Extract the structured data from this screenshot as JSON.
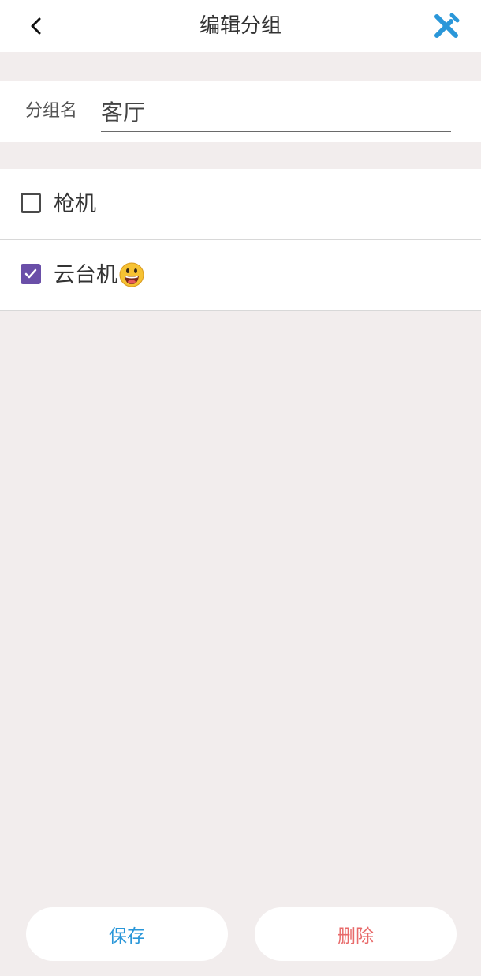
{
  "header": {
    "title": "编辑分组",
    "back_icon": "chevron-left-icon",
    "tools_icon": "tools-icon",
    "tools_color": "#2a97d9"
  },
  "group_name": {
    "label": "分组名",
    "value": "客厅"
  },
  "devices": [
    {
      "label": "枪机",
      "checked": false
    },
    {
      "label": "云台机",
      "checked": true,
      "emoji_icon": "grinning-face-icon"
    }
  ],
  "actions": {
    "save_label": "保存",
    "delete_label": "删除"
  },
  "colors": {
    "background": "#f2eded",
    "accent_purple": "#6a4fa8",
    "save_blue": "#2a97d9",
    "delete_red": "#e86a6a"
  }
}
